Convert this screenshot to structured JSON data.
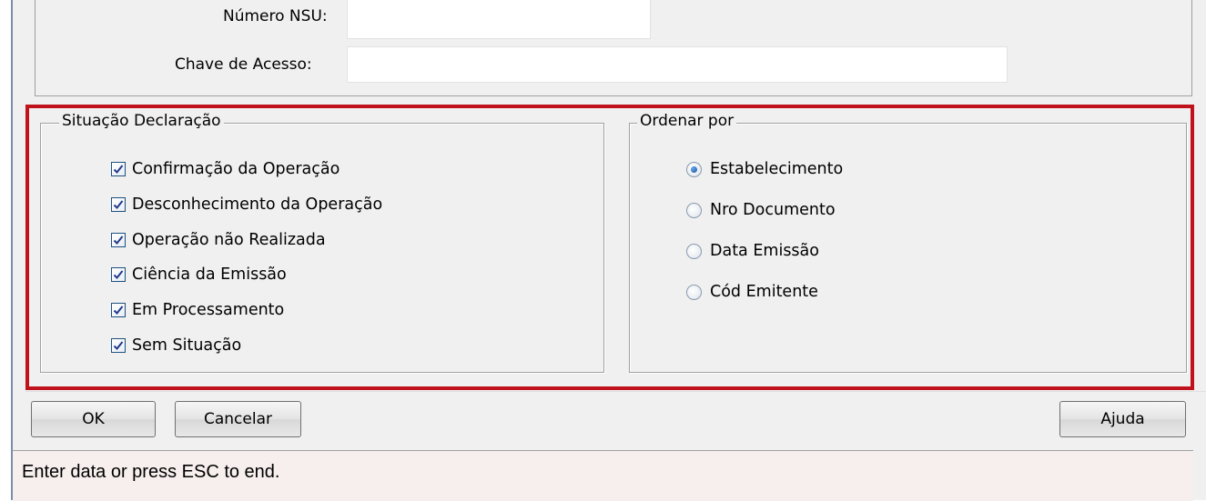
{
  "form": {
    "nsu_label": "Número NSU:",
    "nsu_value": "",
    "chave_label": "Chave de Acesso:",
    "chave_value": ""
  },
  "situacao": {
    "title": "Situação Declaração",
    "items": [
      {
        "label": "Confirmação da Operação",
        "checked": true
      },
      {
        "label": "Desconhecimento da Operação",
        "checked": true
      },
      {
        "label": "Operação não Realizada",
        "checked": true
      },
      {
        "label": "Ciência da Emissão",
        "checked": true
      },
      {
        "label": "Em Processamento",
        "checked": true
      },
      {
        "label": "Sem Situação",
        "checked": true
      }
    ]
  },
  "ordenar": {
    "title": "Ordenar por",
    "options": [
      {
        "label": "Estabelecimento",
        "selected": true
      },
      {
        "label": "Nro Documento",
        "selected": false
      },
      {
        "label": "Data Emissão",
        "selected": false
      },
      {
        "label": "Cód Emitente",
        "selected": false
      }
    ]
  },
  "buttons": {
    "ok": "OK",
    "cancel": "Cancelar",
    "help": "Ajuda"
  },
  "status": {
    "message": "Enter data or press ESC to end."
  },
  "colors": {
    "highlight": "#c0121b",
    "window_bg": "#f0f0f0",
    "status_bg": "#f7efee"
  }
}
